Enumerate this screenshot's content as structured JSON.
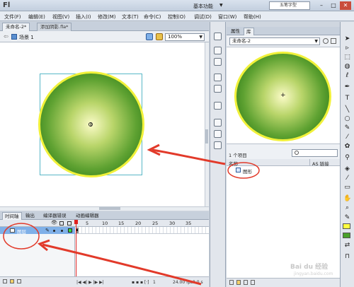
{
  "app": {
    "logo": "Fl",
    "workspace": "基本功能",
    "search_placeholder": "五笔字型"
  },
  "menu": [
    "文件(F)",
    "编辑(E)",
    "视图(V)",
    "插入(I)",
    "修改(M)",
    "文本(T)",
    "命令(C)",
    "控制(O)",
    "调试(D)",
    "窗口(W)",
    "帮助(H)"
  ],
  "doc_tabs": [
    {
      "label": "未命名-2*"
    },
    {
      "label": "添加阴影.fla*"
    }
  ],
  "editbar": {
    "scene": "场景 1",
    "zoom": "100%"
  },
  "timeline": {
    "tabs": [
      "时间轴",
      "输出",
      "编译器错误",
      "动画编辑器"
    ],
    "frame_numbers": [
      "5",
      "10",
      "15",
      "20",
      "25",
      "30",
      "35"
    ],
    "layer_name": "图层",
    "fps": "24.00 fps",
    "time": "0.0 s",
    "current_frame": "1"
  },
  "library": {
    "tabs": [
      "属性",
      "库"
    ],
    "document": "未命名-2",
    "item_count": "1 个项目",
    "columns": {
      "name": "名称",
      "linkage": "AS 链接"
    },
    "items": [
      {
        "label": "图形",
        "icon": "graphic-symbol-icon"
      }
    ]
  },
  "colors": {
    "stroke": "#f1f13a",
    "fill_center": "#fbfbc8",
    "fill_edge": "#1f6a10",
    "annotation": "#e23a2a"
  },
  "watermark": {
    "text": "Bai du 经验",
    "sub": "jingyan.baidu.com"
  }
}
